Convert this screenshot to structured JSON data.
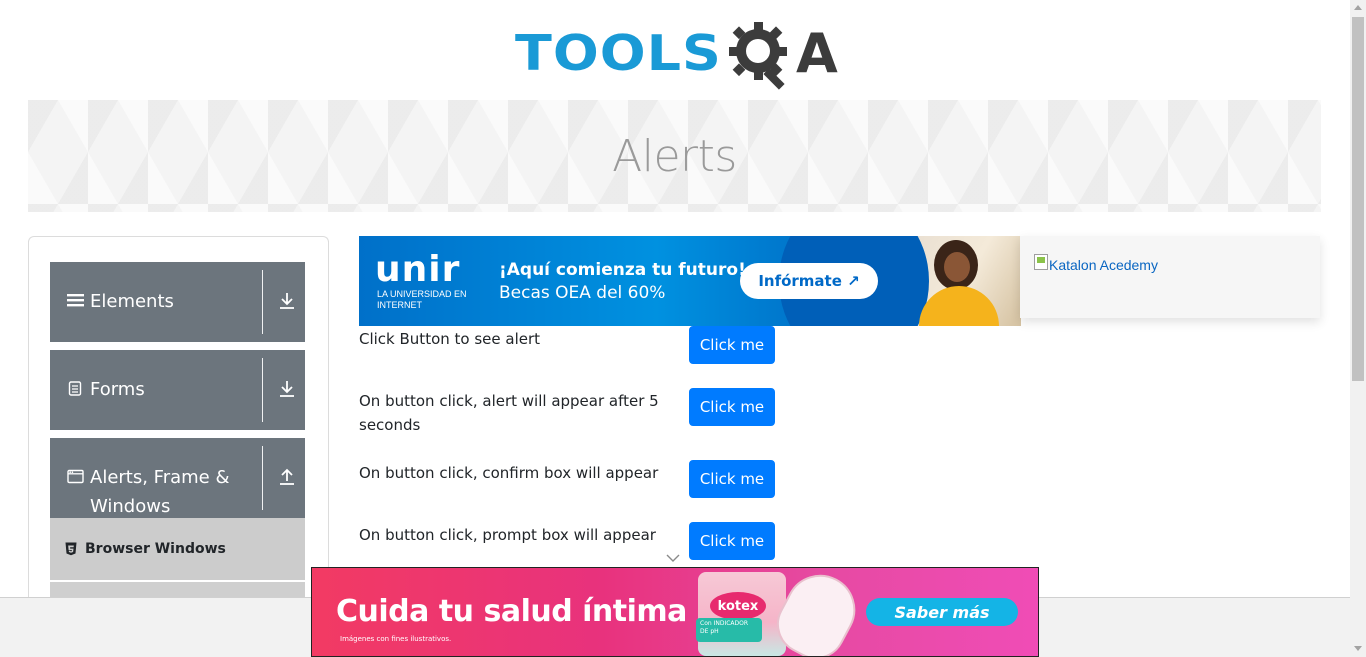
{
  "header": {
    "logo_text_left": "TOOLS",
    "logo_text_right": "A"
  },
  "page": {
    "title": "Alerts"
  },
  "sidebar": {
    "groups": [
      {
        "label": "Elements",
        "icon": "hamburger-icon",
        "arrow": "download-icon"
      },
      {
        "label": "Forms",
        "icon": "document-icon",
        "arrow": "download-icon"
      },
      {
        "label": "Alerts, Frame & Windows",
        "icon": "window-icon",
        "arrow": "upload-icon"
      }
    ],
    "subitems": [
      {
        "label": "Browser Windows",
        "icon": "html5-icon"
      }
    ]
  },
  "ads": {
    "top": {
      "brand": "unir",
      "brand_sub": "LA UNIVERSIDAD EN INTERNET",
      "headline": "¡Aquí comienza tu futuro!",
      "subline": "Becas OEA del 60%",
      "cta": "Infórmate ↗"
    },
    "right": {
      "alt_text": "Katalon Acedemy"
    },
    "bottom": {
      "title": "Cuida tu salud íntima",
      "disclaimer": "Imágenes con fines ilustrativos.",
      "product_logo": "kotex",
      "product_tag": "Con INDICADOR DE pH",
      "cta": "Saber más"
    }
  },
  "alerts": {
    "rows": [
      {
        "label": "Click Button to see alert",
        "button": "Click me"
      },
      {
        "label": "On button click, alert will appear after 5 seconds",
        "button": "Click me"
      },
      {
        "label": "On button click, confirm box will appear",
        "button": "Click me"
      },
      {
        "label": "On button click, prompt box will appear",
        "button": "Click me"
      }
    ]
  },
  "colors": {
    "brand_blue": "#1a9ad6",
    "button_blue": "#007bff",
    "sidebar_gray": "#6c757d",
    "subitem_gray": "#cccccc"
  }
}
